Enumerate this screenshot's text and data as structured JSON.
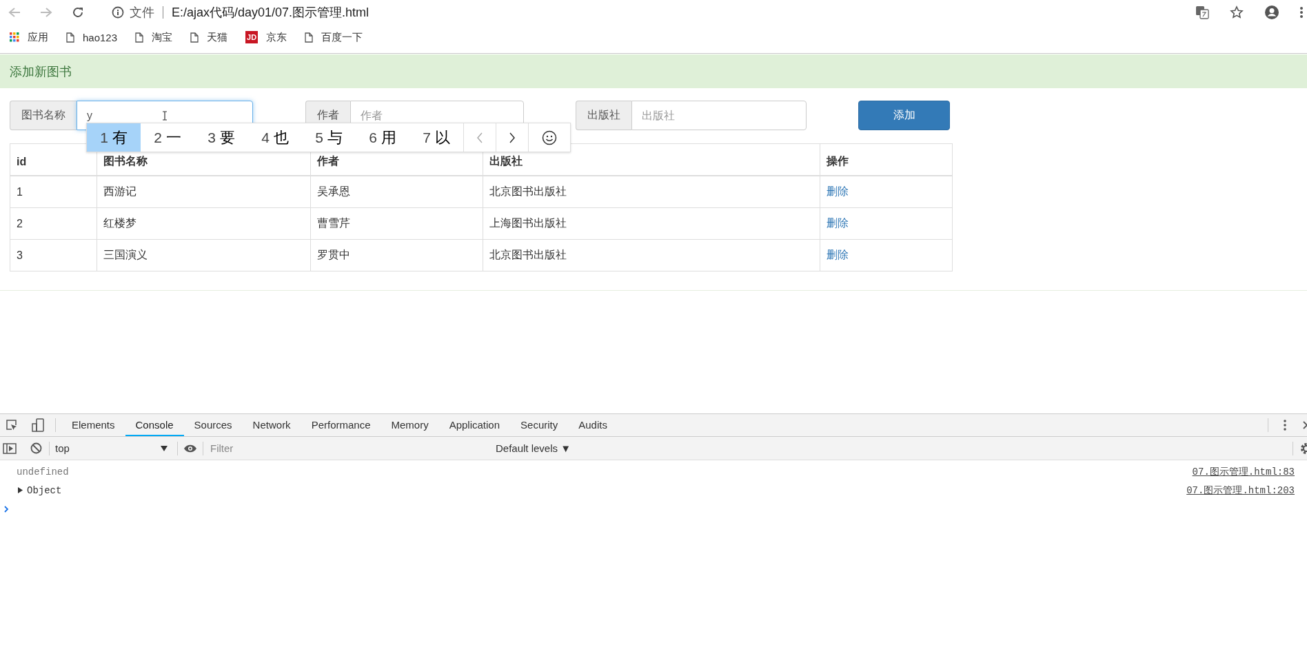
{
  "browser": {
    "scheme_label": "文件",
    "url": "E:/ajax代码/day01/07.图示管理.html",
    "bookmarks": [
      {
        "kind": "apps",
        "label": "应用"
      },
      {
        "kind": "page",
        "label": "hao123"
      },
      {
        "kind": "page",
        "label": "淘宝"
      },
      {
        "kind": "page",
        "label": "天猫"
      },
      {
        "kind": "badge",
        "badge": "JD",
        "label": "京东"
      },
      {
        "kind": "page",
        "label": "百度一下"
      }
    ]
  },
  "panel": {
    "title": "添加新图书",
    "fields": [
      {
        "label": "图书名称",
        "value": "y",
        "focused": true
      },
      {
        "label": "作者",
        "placeholder": "作者",
        "focused": false
      },
      {
        "label": "出版社",
        "placeholder": "出版社",
        "focused": false
      }
    ],
    "submit_button": "添加",
    "ime": {
      "candidates": [
        {
          "number": "1",
          "text": "有",
          "selected": true
        },
        {
          "number": "2",
          "text": "一",
          "selected": false
        },
        {
          "number": "3",
          "text": "要",
          "selected": false
        },
        {
          "number": "4",
          "text": "也",
          "selected": false
        },
        {
          "number": "5",
          "text": "与",
          "selected": false
        },
        {
          "number": "6",
          "text": "用",
          "selected": false
        },
        {
          "number": "7",
          "text": "以",
          "selected": false
        }
      ],
      "prev_disabled": true
    },
    "table": {
      "columns": [
        "id",
        "图书名称",
        "作者",
        "出版社",
        "操作"
      ],
      "rows": [
        {
          "id": "1",
          "name": "西游记",
          "author": "吴承恩",
          "publisher": "北京图书出版社",
          "action": "删除"
        },
        {
          "id": "2",
          "name": "红楼梦",
          "author": "曹雪芹",
          "publisher": "上海图书出版社",
          "action": "删除"
        },
        {
          "id": "3",
          "name": "三国演义",
          "author": "罗贯中",
          "publisher": "北京图书出版社",
          "action": "删除"
        }
      ]
    }
  },
  "devtools": {
    "tabs": [
      {
        "label": "Elements",
        "selected": false
      },
      {
        "label": "Console",
        "selected": true
      },
      {
        "label": "Sources",
        "selected": false
      },
      {
        "label": "Network",
        "selected": false
      },
      {
        "label": "Performance",
        "selected": false
      },
      {
        "label": "Memory",
        "selected": false
      },
      {
        "label": "Application",
        "selected": false
      },
      {
        "label": "Security",
        "selected": false
      },
      {
        "label": "Audits",
        "selected": false
      }
    ],
    "context": "top",
    "filter_placeholder": "Filter",
    "levels": "Default levels ▼",
    "messages": [
      {
        "kind": "value",
        "text": "undefined",
        "source": "07.图示管理.html:83"
      },
      {
        "kind": "object",
        "text": "Object",
        "source": "07.图示管理.html:203"
      }
    ]
  }
}
